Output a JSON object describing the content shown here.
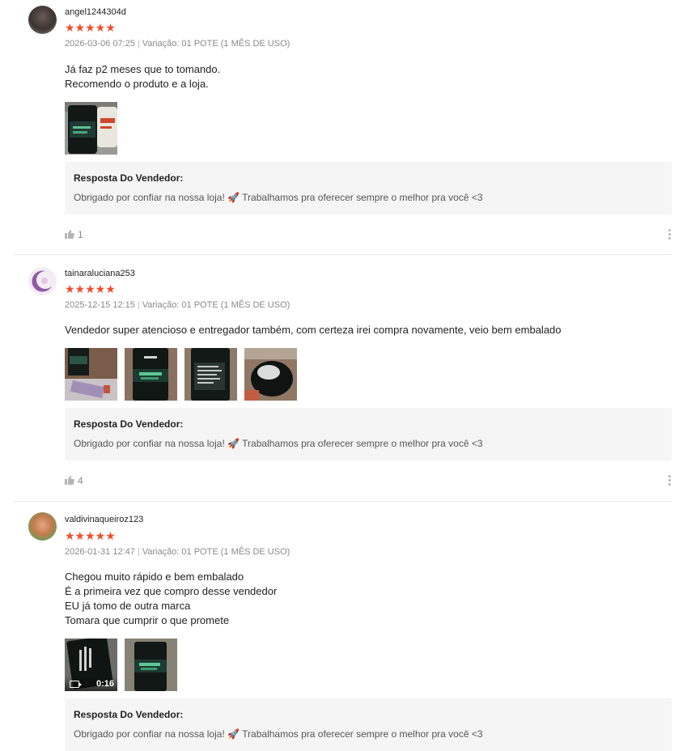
{
  "reviews": [
    {
      "username": "angel1244304d",
      "stars": "★★★★★",
      "date": "2026-03-06 07:25",
      "variation": "Variação: 01 POTE (1 MÊS DE USO)",
      "comment": [
        "Já faz p2 meses que to tomando.",
        "Recomendo o produto e a loja."
      ],
      "reply_title": "Resposta Do Vendedor:",
      "reply_text": "Obrigado por confiar na nossa loja! 🚀 Trabalhamos pra oferecer sempre o melhor pra você <3",
      "likes": "1"
    },
    {
      "username": "tainaraluciana253",
      "stars": "★★★★★",
      "date": "2025-12-15 12:15",
      "variation": "Variação: 01 POTE (1 MÊS DE USO)",
      "comment": [
        "Vendedor super atencioso e entregador também, com certeza irei compra novamente, veio bem embalado"
      ],
      "reply_title": "Resposta Do Vendedor:",
      "reply_text": "Obrigado por confiar na nossa loja! 🚀 Trabalhamos pra oferecer sempre o melhor pra você <3",
      "likes": "4"
    },
    {
      "username": "valdivinaqueiroz123",
      "stars": "★★★★★",
      "date": "2026-01-31 12:47",
      "variation": "Variação: 01 POTE (1 MÊS DE USO)",
      "comment": [
        "Chegou muito rápido e bem embalado",
        "É a primeira vez que compro desse vendedor",
        "EU já tomo de outra marca",
        "Tomara que cumprir o que promete"
      ],
      "video_duration": "0:16",
      "reply_title": "Resposta Do Vendedor:",
      "reply_text": "Obrigado por confiar na nossa loja! 🚀 Trabalhamos pra oferecer sempre o melhor pra você <3"
    }
  ],
  "colors": {
    "star": "#ee4d2d",
    "reply_bg": "#f5f5f5",
    "meta": "#8a8a8a"
  },
  "icons": [
    "thumbs-up-icon",
    "more-vertical-icon",
    "video-camera-icon"
  ]
}
